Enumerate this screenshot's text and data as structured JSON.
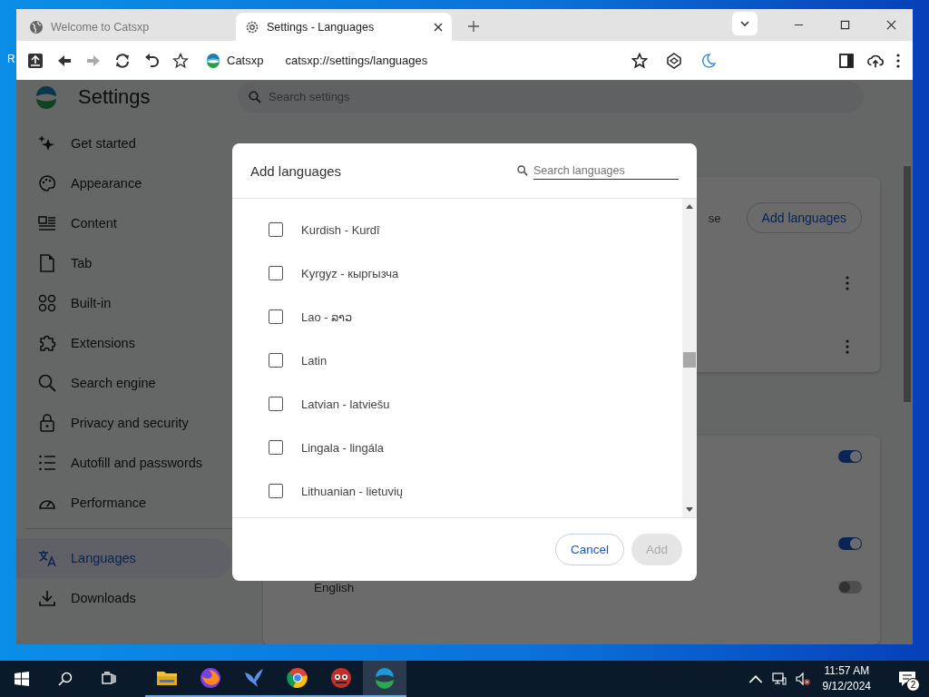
{
  "desktop": {
    "icon_fragment": "R"
  },
  "window": {
    "tabs": [
      {
        "title": "Welcome to Catsxp",
        "selected": false
      },
      {
        "title": "Settings - Languages",
        "selected": true
      }
    ],
    "toolbar": {
      "site_name": "Catsxp",
      "url": "catsxp://settings/languages"
    }
  },
  "settings": {
    "title": "Settings",
    "search": {
      "placeholder": "Search settings"
    },
    "sidebar": {
      "items": [
        {
          "label": "Get started",
          "selected": false
        },
        {
          "label": "Appearance",
          "selected": false
        },
        {
          "label": "Content",
          "selected": false
        },
        {
          "label": "Tab",
          "selected": false
        },
        {
          "label": "Built-in",
          "selected": false
        },
        {
          "label": "Extensions",
          "selected": false
        },
        {
          "label": "Search engine",
          "selected": false
        },
        {
          "label": "Privacy and security",
          "selected": false
        },
        {
          "label": "Autofill and passwords",
          "selected": false
        },
        {
          "label": "Performance",
          "selected": false
        },
        {
          "label": "Languages",
          "selected": true
        },
        {
          "label": "Downloads",
          "selected": false
        }
      ]
    },
    "languages_card": {
      "partial_text": "se",
      "add_button": "Add languages"
    },
    "spell_card": {
      "toggles": [
        {
          "on": true
        },
        {
          "on": true
        },
        {
          "on": false,
          "label": "English"
        }
      ]
    }
  },
  "dialog": {
    "title": "Add languages",
    "search": {
      "placeholder": "Search languages"
    },
    "languages": [
      {
        "label": "Kurdish - Kurdî",
        "checked": false
      },
      {
        "label": "Kyrgyz - кыргызча",
        "checked": false
      },
      {
        "label": "Lao - ລາວ",
        "checked": false
      },
      {
        "label": "Latin",
        "checked": false
      },
      {
        "label": "Latvian - latviešu",
        "checked": false
      },
      {
        "label": "Lingala - lingála",
        "checked": false
      },
      {
        "label": "Lithuanian - lietuvių",
        "checked": false
      }
    ],
    "buttons": [
      {
        "label": "Cancel",
        "kind": "secondary",
        "disabled": false
      },
      {
        "label": "Add",
        "kind": "primary",
        "disabled": true
      }
    ]
  },
  "taskbar": {
    "apps": [
      {
        "active": false
      },
      {
        "active": false
      },
      {
        "active": false
      },
      {
        "active": false
      },
      {
        "active": false
      },
      {
        "active": true
      }
    ],
    "time": "11:57 AM",
    "date": "9/12/2024",
    "notifications": "2"
  }
}
